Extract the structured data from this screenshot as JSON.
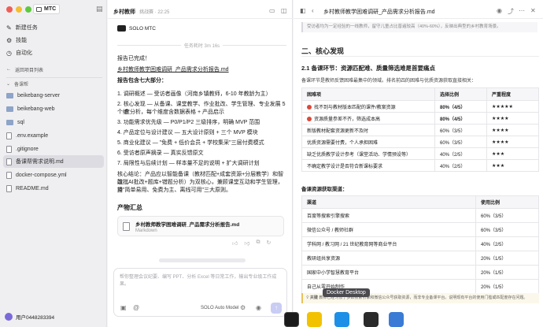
{
  "sidebar": {
    "workspace": "MTC",
    "nav": [
      {
        "label": "新建任务",
        "icon": "compose-icon"
      },
      {
        "label": "技能",
        "icon": "skill-icon"
      },
      {
        "label": "自动化",
        "icon": "clock-icon"
      }
    ],
    "back_label": "返回项目列表",
    "project": "备课帮",
    "files": [
      {
        "name": "beikebang-server",
        "type": "folder"
      },
      {
        "name": "beikebang-web",
        "type": "folder"
      },
      {
        "name": "sql",
        "type": "folder"
      },
      {
        "name": ".env.example",
        "type": "file"
      },
      {
        "name": ".gitignore",
        "type": "file"
      },
      {
        "name": "备课帮需求说明.md",
        "type": "file"
      },
      {
        "name": "docker-compose.yml",
        "type": "file"
      },
      {
        "name": "README.md",
        "type": "file"
      }
    ],
    "user": "用户0448283394"
  },
  "chat": {
    "title": "乡村教师",
    "subtitle": "挑战赛 · 22:25",
    "agent": "SOLO MTC",
    "duration": "任务耗时 3m 16s",
    "lines": [
      "报告已完成！",
      "乡村教师教学困难调研_产品需求分析报告.md",
      "报告包含七大部分：",
      "1. 调研概述 — 受访者画像（河南乡镇教师，6-10 年教龄为主）",
      "2. 核心发现 — 从备课、课堂教学、作业批改、学生管理、专业发展 5 个维",
      "度分析，每个维度含数据表格 + 产品启示",
      "3. 功能需求优先级 — P0/P1/P2 三级排序，明确 MVP 范围",
      "4. 产品定位与设计建议 — 五大设计原则 + 三个 MVP 模块",
      "5. 商业化建议 — \"免费 + 低价会员 + 学校集采\"三层付费模式",
      "6. 受访者原声摘录 — 真实反馈原文",
      "7. 局限性与后续计划 — 样本量不足的说明 + 扩大调研计划",
      "核心结论：产品应以智能备课（教材匹配+成套资源+分层教学）和智能批",
      "改（AI批改+题库+错题分析）为双核心，兼顾课堂互动和学生管理，坚",
      "持\"简单易用、免费为主、离线可用\"三大原则。"
    ],
    "artifacts_heading": "产物汇总",
    "artifact_name": "乡村教师教学困难调研_产品需求分析报告.md",
    "artifact_type": "Markdown",
    "input_placeholder": "帮你整理会议纪要、编写 PPT、分析 Excel 等日常工作，输出专业级工作成果。",
    "model": "SOLO Auto Model"
  },
  "doc": {
    "filename": "乡村教师教学困难调研_产品需求分析报告.md",
    "intro": "受访者均为一定经验的一线教师，留守儿童占比普遍较高（40%-60%），反映出典型的乡村教育场景。",
    "h2": "二、核心发现",
    "h3": "2.1 备课环节：资源匹配难、质量筛选难是首要痛点",
    "p1": "备课环节是教师反馈困难最集中的领域。排名前四的困难与优质资源获取直接相关：",
    "table1": {
      "headers": [
        "困难项",
        "选择比例",
        "严重程度"
      ],
      "rows": [
        {
          "dot": "#d94a3a",
          "item": "找不到与教材版本匹配的课件/教案资源",
          "pct": "80%（4/5）",
          "stars": "★★★★★",
          "bold": true
        },
        {
          "dot": "#d94a3a",
          "item": "资源质量参差不齐，筛选成本高",
          "pct": "80%（4/5）",
          "stars": "★★★★",
          "bold": true
        },
        {
          "dot": "",
          "item": "新版教材配套资源更新不及时",
          "pct": "60%（3/5）",
          "stars": "★★★★",
          "bold": false
        },
        {
          "dot": "",
          "item": "优质资源需要付费，个人承担困难",
          "pct": "60%（3/5）",
          "stars": "★★★★",
          "bold": false
        },
        {
          "dot": "",
          "item": "缺乏优质教学设计参考（课堂活动、学情预设等）",
          "pct": "40%（2/5）",
          "stars": "★★★",
          "bold": false
        },
        {
          "dot": "",
          "item": "不确定教学设计是否符合新课标要求",
          "pct": "40%（2/5）",
          "stars": "★★★",
          "bold": false
        }
      ]
    },
    "h4": "备课资源获取渠道：",
    "table2": {
      "headers": [
        "渠道",
        "使用比例"
      ],
      "rows": [
        {
          "item": "百度等搜索引擎搜索",
          "pct": "60%（3/5）"
        },
        {
          "item": "微信公众号 / 教师社群",
          "pct": "60%（3/5）"
        },
        {
          "item": "学科网 / 教习网 / 21 世纪教育网等商业平台",
          "pct": "40%（2/5）"
        },
        {
          "item": "教研组共享资源",
          "pct": "20%（1/5）"
        },
        {
          "item": "国家中小学智慧教育平台",
          "pct": "20%（1/5）"
        },
        {
          "item": "自己从零开始制作",
          "pct": "20%（1/5）"
        }
      ]
    },
    "footnote_label": "关键",
    "footnote": "教师已经习惯于多数搜索引擎和微信公众号获取资源，而非专业备课平台。说明现有平台的使用门槛或匹配度存在问题。",
    "tooltip": "Docker Desktop"
  },
  "dock": {
    "apps": [
      "JetBrains",
      "Notes",
      "Docker",
      "Screenshot",
      "Arrow"
    ],
    "colors": [
      "#1b1b1b",
      "#f2c200",
      "#1d8fe6",
      "#2b2b2b",
      "#3a7bd5"
    ]
  },
  "colors": {
    "accent": "#4b5bdc",
    "red": "#d94a3a",
    "sidebar": "#efeff1"
  }
}
